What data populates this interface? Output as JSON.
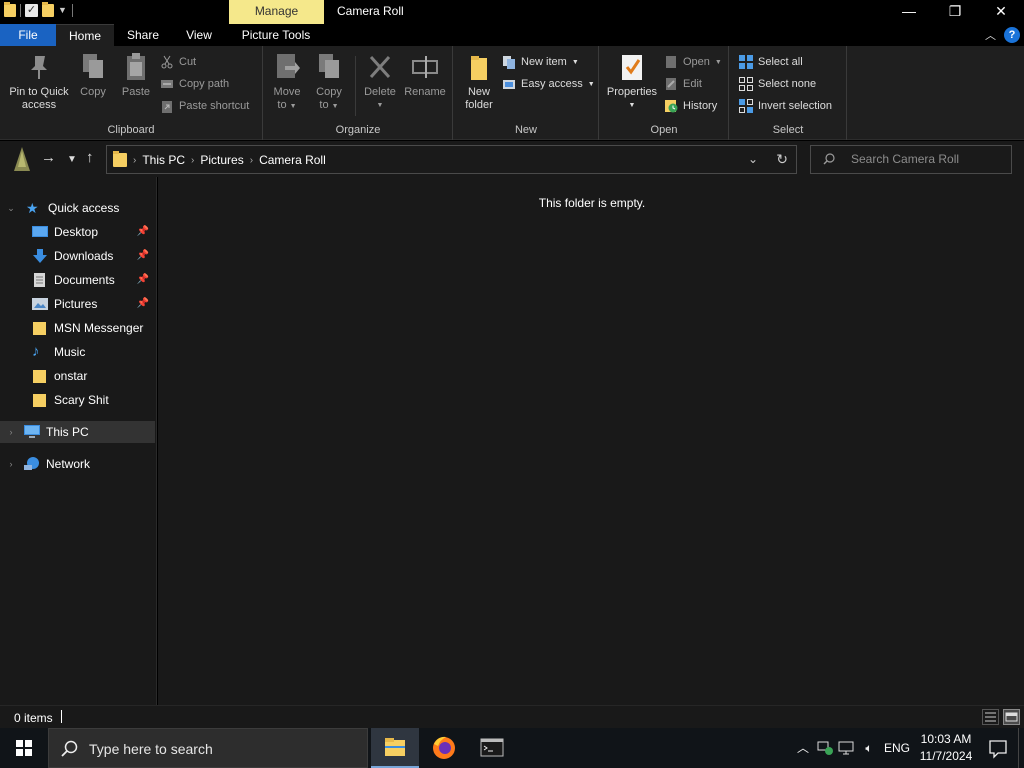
{
  "titlebar": {
    "manage_tab": "Manage",
    "title": "Camera Roll",
    "minimize": "—",
    "maximize": "❐",
    "close": "✕"
  },
  "tabs": {
    "file": "File",
    "home": "Home",
    "share": "Share",
    "view": "View",
    "picture_tools": "Picture Tools",
    "help": "?",
    "collapse": "︿"
  },
  "ribbon": {
    "clipboard": {
      "label": "Clipboard",
      "pin_line1": "Pin to Quick",
      "pin_line2": "access",
      "copy": "Copy",
      "paste": "Paste",
      "cut": "Cut",
      "copy_path": "Copy path",
      "paste_shortcut": "Paste shortcut"
    },
    "organize": {
      "label": "Organize",
      "move_line1": "Move",
      "move_line2": "to",
      "copy_line1": "Copy",
      "copy_line2": "to",
      "delete": "Delete",
      "rename": "Rename"
    },
    "new": {
      "label": "New",
      "new_folder_line1": "New",
      "new_folder_line2": "folder",
      "new_item": "New item",
      "easy_access": "Easy access"
    },
    "open": {
      "label": "Open",
      "properties": "Properties",
      "open": "Open",
      "edit": "Edit",
      "history": "History"
    },
    "select": {
      "label": "Select",
      "select_all": "Select all",
      "select_none": "Select none",
      "invert_selection": "Invert selection"
    }
  },
  "address": {
    "crumbs": [
      "This PC",
      "Pictures",
      "Camera Roll"
    ],
    "search_placeholder": "Search Camera Roll"
  },
  "navpane": {
    "quick_access": "Quick access",
    "items": [
      {
        "label": "Desktop",
        "pinned": true
      },
      {
        "label": "Downloads",
        "pinned": true
      },
      {
        "label": "Documents",
        "pinned": true
      },
      {
        "label": "Pictures",
        "pinned": true
      },
      {
        "label": "MSN Messenger",
        "pinned": false
      },
      {
        "label": "Music",
        "pinned": false
      },
      {
        "label": "onstar",
        "pinned": false
      },
      {
        "label": "Scary Shit",
        "pinned": false
      }
    ],
    "this_pc": "This PC",
    "network": "Network"
  },
  "content": {
    "empty_message": "This folder is empty."
  },
  "status": {
    "items_count": "0 items"
  },
  "taskbar": {
    "search_placeholder": "Type here to search",
    "language": "ENG",
    "time": "10:03 AM",
    "date": "11/7/2024"
  },
  "colors": {
    "accent": "#1a63c2",
    "manage_tab": "#f5e88b",
    "folder": "#f6cf62",
    "background": "#191919"
  }
}
